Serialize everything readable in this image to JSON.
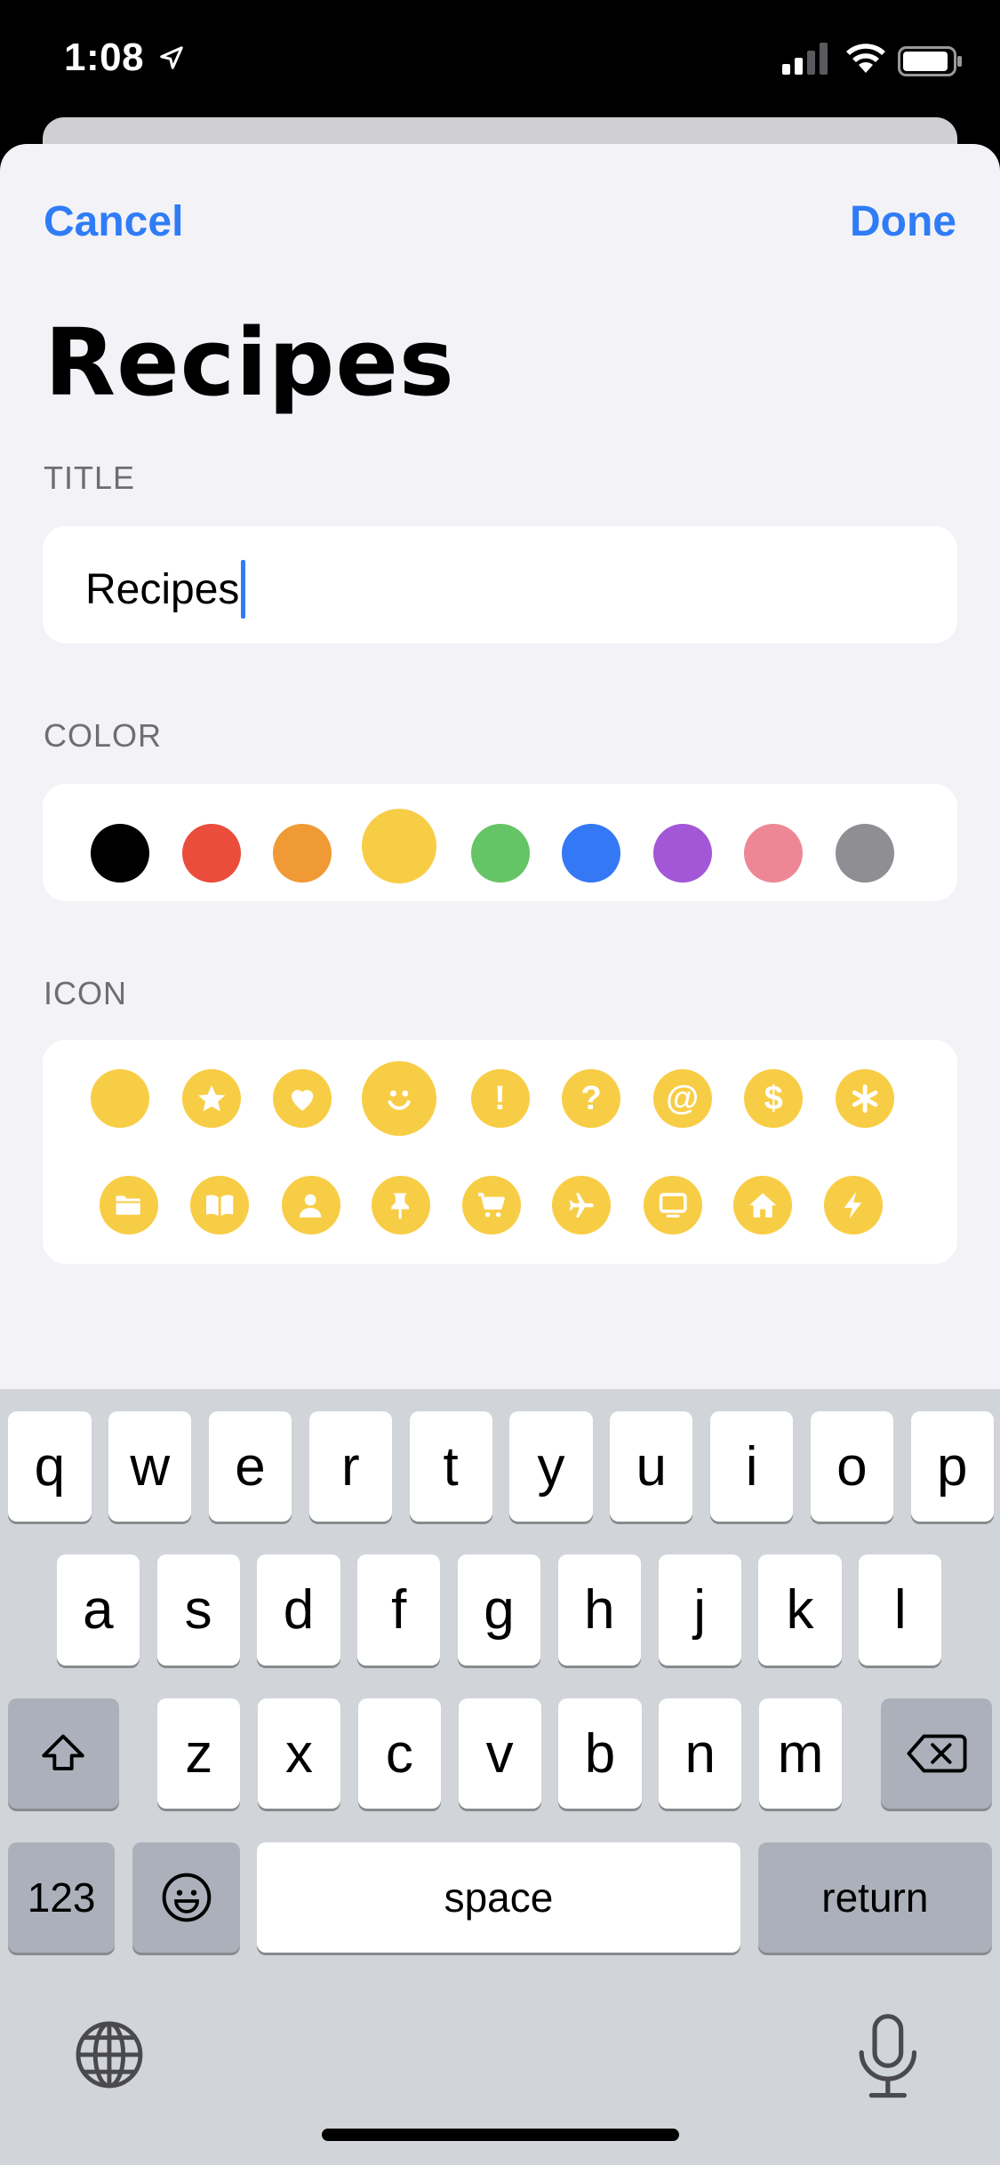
{
  "status_bar": {
    "time": "1:08"
  },
  "nav": {
    "cancel_label": "Cancel",
    "done_label": "Done"
  },
  "page_title": "Recipes",
  "title_section": {
    "label": "TITLE",
    "value": "Recipes"
  },
  "color_section": {
    "label": "COLOR",
    "colors": [
      "#000000",
      "#eb4d3d",
      "#f09a36",
      "#f8cd46",
      "#65c466",
      "#3478f6",
      "#a357d7",
      "#ed8796",
      "#8e8e93"
    ],
    "selected_index": 3
  },
  "icon_section": {
    "label": "ICON",
    "accent": "#f8cd46",
    "icons": [
      "circle",
      "star",
      "heart",
      "smiley",
      "exclamation",
      "question",
      "at",
      "dollar",
      "asterisk",
      "folder",
      "book",
      "person",
      "pin",
      "cart",
      "airplane",
      "monitor",
      "house",
      "bolt"
    ],
    "selected_index": 3
  },
  "keyboard": {
    "row1": [
      "q",
      "w",
      "e",
      "r",
      "t",
      "y",
      "u",
      "i",
      "o",
      "p"
    ],
    "row2": [
      "a",
      "s",
      "d",
      "f",
      "g",
      "h",
      "j",
      "k",
      "l"
    ],
    "row3": [
      "z",
      "x",
      "c",
      "v",
      "b",
      "n",
      "m"
    ],
    "numbers_label": "123",
    "space_label": "space",
    "return_label": "return"
  }
}
